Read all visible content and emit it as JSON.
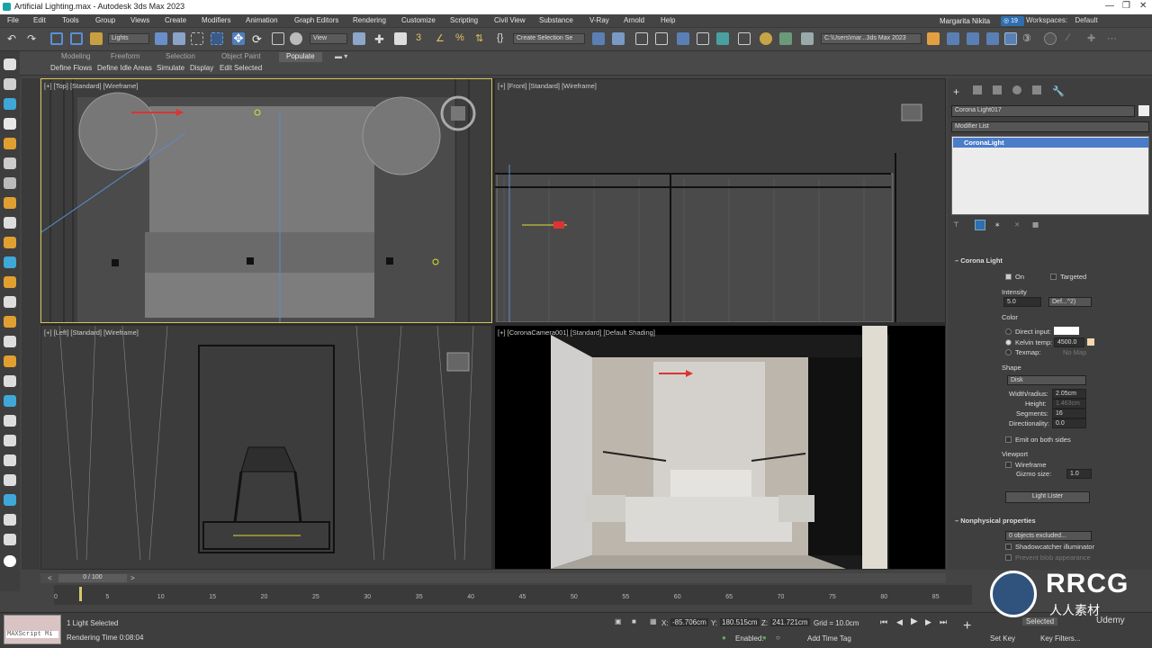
{
  "window": {
    "title": "Artificial Lighting.max - Autodesk 3ds Max 2023"
  },
  "menu": [
    "File",
    "Edit",
    "Tools",
    "Group",
    "Views",
    "Create",
    "Modifiers",
    "Animation",
    "Graph Editors",
    "Rendering",
    "Customize",
    "Scripting",
    "Civil View",
    "Substance",
    "V-Ray",
    "Arnold",
    "Help"
  ],
  "account": {
    "user": "Margarita Nikita",
    "notifications": "19",
    "workspaces_label": "Workspaces:",
    "workspace": "Default"
  },
  "toolbar": {
    "selection_filter": "Lights",
    "ref_coord": "View",
    "named_selection": "Create Selection Se",
    "project_path": "C:\\Users\\mar...3ds Max 2023"
  },
  "ribbon": {
    "tabs": [
      "Modeling",
      "Freeform",
      "Selection",
      "Object Paint",
      "Populate"
    ],
    "active_tab": "Populate",
    "sub": [
      "Define Flows",
      "Define Idle Areas",
      "Simulate",
      "Display",
      "Edit Selected"
    ]
  },
  "viewports": {
    "top": "[+] [Top] [Standard] [Wireframe]",
    "front": "[+] [Front] [Standard] [Wireframe]",
    "left": "[+] [Left] [Standard] [Wireframe]",
    "camera": "[+] [CoronaCamera001] [Standard] [Default Shading]"
  },
  "command_panel": {
    "object_name": "Corona Light017",
    "modifier_list": "Modifier List",
    "stack_item": "CoronaLight",
    "rollout_title": "Corona Light",
    "on_label": "On",
    "targeted_label": "Targeted",
    "intensity_label": "Intensity",
    "intensity_value": "5.0",
    "intensity_unit": "Def...^2)",
    "color_label": "Color",
    "direct_input": "Direct input:",
    "kelvin_label": "Kelvin temp:",
    "kelvin_value": "4500.0",
    "texmap_label": "Texmap:",
    "no_map": "No Map",
    "shape_label": "Shape",
    "shape_value": "Disk",
    "width_label": "Width/radius:",
    "width_value": "2.05cm",
    "height_label": "Height:",
    "height_value": "1.463cm",
    "segments_label": "Segments:",
    "segments_value": "16",
    "directionality_label": "Directionality:",
    "directionality_value": "0.0",
    "emit_both": "Emit on both sides",
    "viewport_label": "Viewport",
    "wireframe_label": "Wireframe",
    "gizmo_label": "Gizmo size:",
    "gizmo_value": "1.0",
    "light_lister": "Light Lister",
    "nonphysical_title": "Nonphysical properties",
    "objects_excluded": "0 objects excluded...",
    "shadowcatcher": "Shadowcatcher illuminator",
    "prevent_blob": "Prevent blob appearance"
  },
  "timeline": {
    "frame_counter": "0 / 100",
    "ticks": [
      "0",
      "5",
      "10",
      "15",
      "20",
      "25",
      "30",
      "35",
      "40",
      "45",
      "50",
      "55",
      "60",
      "65",
      "70",
      "75",
      "80",
      "85"
    ]
  },
  "status": {
    "maxscript": "MAXScript Mi",
    "selected": "1 Light Selected",
    "render_time": "Rendering Time  0:08:04",
    "x": "-85.706cm",
    "y": "180.515cm",
    "z": "241.721cm",
    "grid": "Grid = 10.0cm",
    "enabled": "Enabled:",
    "add_time_tag": "Add Time Tag",
    "set_key": "Set Key",
    "key_filters": "Key Filters...",
    "selected_dd": "Selected"
  },
  "watermark": {
    "brand": "RRCG",
    "sub": "人人素材",
    "sub2": "Udemy"
  }
}
